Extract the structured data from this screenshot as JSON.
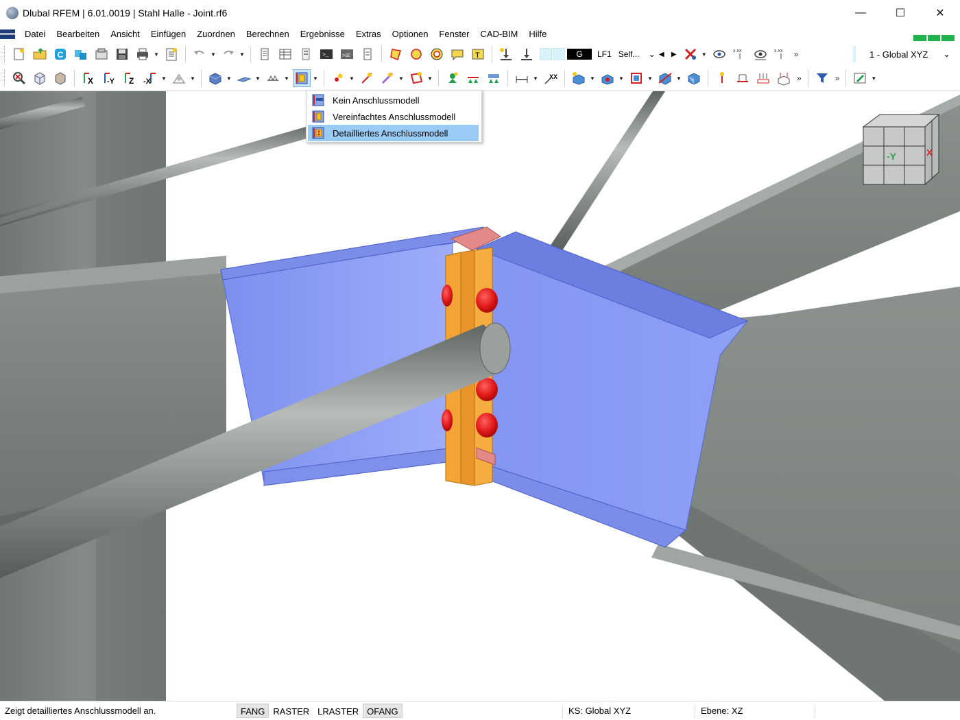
{
  "window": {
    "title": "Dlubal RFEM | 6.01.0019 | Stahl Halle - Joint.rf6",
    "minimize_glyph": "—",
    "maximize_glyph": "☐",
    "close_glyph": "✕"
  },
  "menu": {
    "items": [
      "Datei",
      "Bearbeiten",
      "Ansicht",
      "Einfügen",
      "Zuordnen",
      "Berechnen",
      "Ergebnisse",
      "Extras",
      "Optionen",
      "Fenster",
      "CAD-BIM",
      "Hilfe"
    ]
  },
  "toolbar1": {
    "loadcase_code": "G",
    "loadcase_name": "LF1",
    "loadcase_type": "Self...",
    "nav_prev": "◀",
    "nav_next": "▶",
    "label_xxx_1": "x.xx",
    "label_xxx_2": "x.xx",
    "more": "»",
    "coordinate_system": "1 - Global XYZ",
    "cs_chevron": "⌄"
  },
  "toolbar2": {
    "axis_x": "X",
    "axis_neg_y": "-Y",
    "axis_z": "Z",
    "axis_neg_x": "-X",
    "label_xx": "XX",
    "more": "»"
  },
  "viewcube": {
    "neg_y_label": "-Y",
    "x_label": "X"
  },
  "dropdown": {
    "items": [
      {
        "label": "Kein Anschlussmodell"
      },
      {
        "label": "Vereinfachtes Anschlussmodell"
      },
      {
        "label": "Detailliertes Anschlussmodell",
        "selected": true
      }
    ]
  },
  "statusbar": {
    "message": "Zeigt detailliertes Anschlussmodell an.",
    "toggles": [
      {
        "label": "FANG",
        "on": true
      },
      {
        "label": "RASTER",
        "on": false
      },
      {
        "label": "LRASTER",
        "on": false
      },
      {
        "label": "OFANG",
        "on": true
      }
    ],
    "cs": "KS: Global XYZ",
    "plane": "Ebene: XZ"
  },
  "colors": {
    "steel_plate": "#8c9ef7",
    "end_plate": "#f0a030",
    "bolt": "#e01818",
    "selected_item": "#99cbf4"
  }
}
